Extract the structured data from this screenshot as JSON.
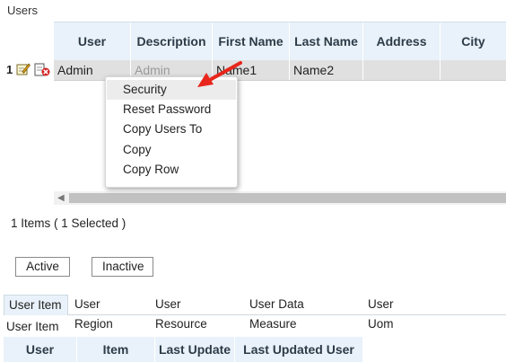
{
  "users_section": {
    "title": "Users",
    "columns": [
      "User",
      "Description",
      "First Name",
      "Last Name",
      "Address",
      "City"
    ],
    "rows": [
      {
        "num": "1",
        "user": "Admin",
        "description": "Admin",
        "first_name": "Name1",
        "last_name": "Name2",
        "address": "",
        "city": ""
      }
    ],
    "items_count": "1 Items ( 1 Selected )"
  },
  "context_menu": {
    "items": [
      "Security",
      "Reset Password",
      "Copy Users To",
      "Copy",
      "Copy Row"
    ],
    "highlighted": "Security"
  },
  "buttons": {
    "active": "Active",
    "inactive": "Inactive"
  },
  "tabs": [
    {
      "label": "User Item",
      "active": true
    },
    {
      "label": "User Region",
      "active": false
    },
    {
      "label": "User Resource",
      "active": false
    },
    {
      "label": "User Data Measure",
      "active": false
    },
    {
      "label": "User Uom",
      "active": false
    }
  ],
  "user_item_section": {
    "title": "User Item",
    "columns": [
      "User",
      "Item",
      "Last Update",
      "Last Updated User"
    ]
  },
  "colors": {
    "header_bg": "#e9f2fa",
    "selected_row_bg": "#e0e0e0",
    "arrow": "#e8261c"
  },
  "icons": [
    "edit-icon",
    "delete-icon",
    "scroll-left-arrow-icon",
    "red-pointer-arrow"
  ]
}
